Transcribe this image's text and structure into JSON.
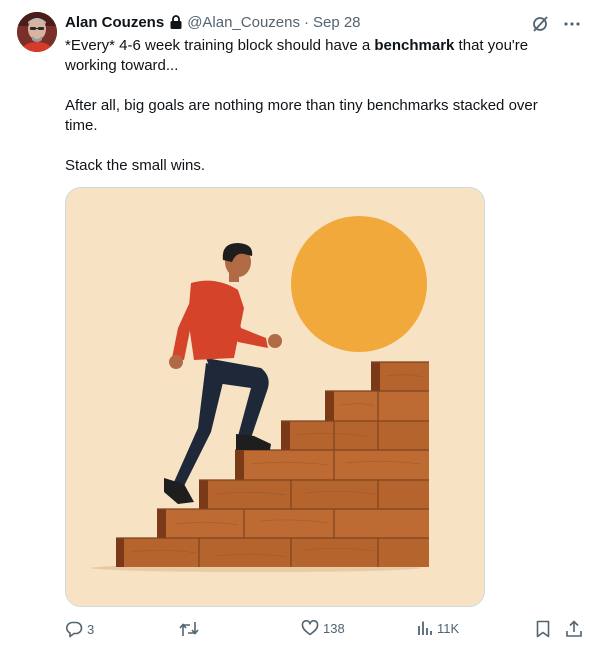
{
  "author": {
    "name": "Alan Couzens",
    "handle": "@Alan_Couzens",
    "separator": "·",
    "time": "Sep 28"
  },
  "text": {
    "line1_pre": "*Every* 4-6 week training block should have a ",
    "line1_bold": "benchmark",
    "line1_post": " that you're working toward...",
    "para2": "After all, big goals are nothing more than tiny benchmarks stacked over time.",
    "para3": "Stack the small wins."
  },
  "stats": {
    "replies": "3",
    "retweets": "",
    "likes": "138",
    "views": "11K"
  },
  "colors": {
    "accent": "#536471",
    "media_bg": "#f7e2c3",
    "sun": "#f2a93b",
    "brick": "#b5642e",
    "shirt": "#d5442a",
    "pants": "#1f2839"
  },
  "icons": {
    "avatar": "avatar-photo",
    "lock": "lock-icon",
    "grok": "grok-icon",
    "more": "more-icon",
    "reply": "reply-icon",
    "retweet": "retweet-icon",
    "like": "heart-icon",
    "views": "views-icon",
    "bookmark": "bookmark-icon",
    "share": "share-icon"
  }
}
